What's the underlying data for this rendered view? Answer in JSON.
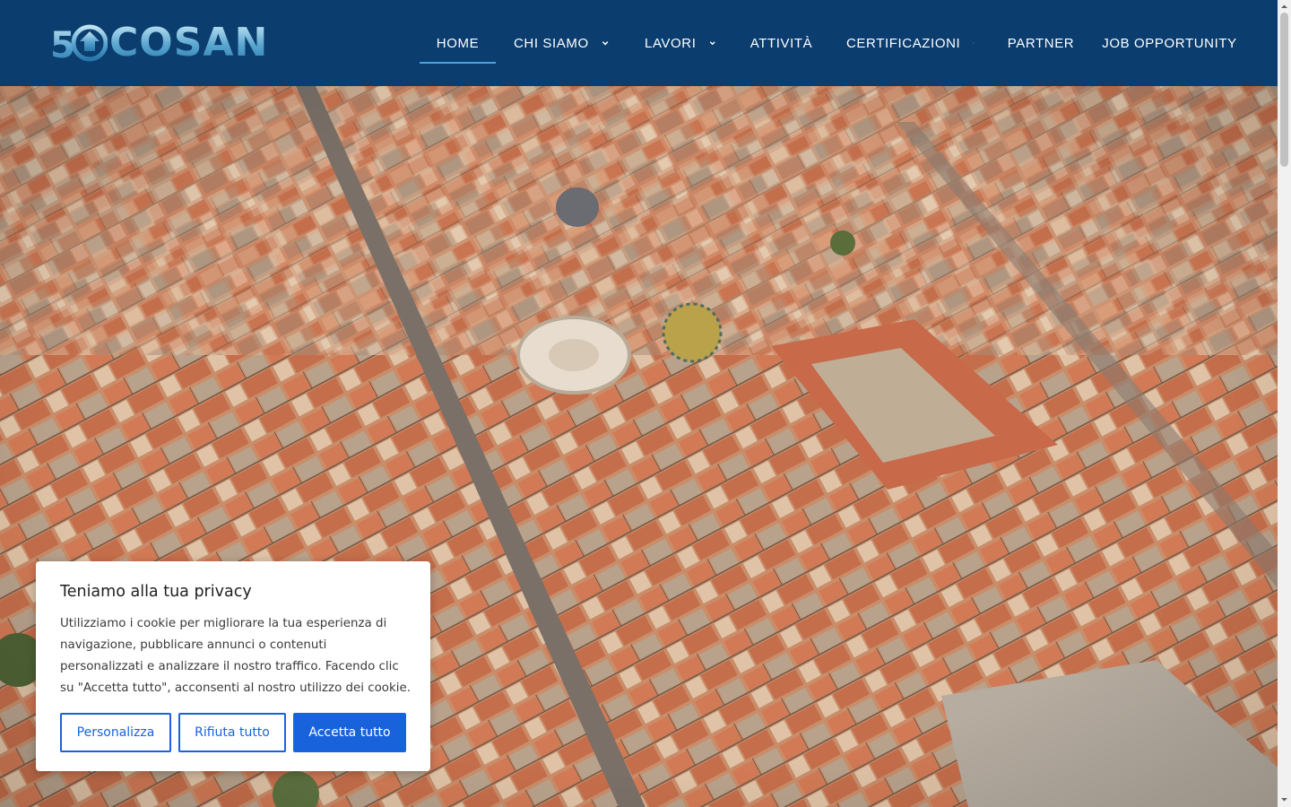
{
  "logo": {
    "mark_text": "50",
    "name": "COSAN"
  },
  "nav": {
    "items": [
      {
        "label": "HOME",
        "active": true,
        "dropdown": false
      },
      {
        "label": "CHI SIAMO",
        "active": false,
        "dropdown": true
      },
      {
        "label": "LAVORI",
        "active": false,
        "dropdown": true
      },
      {
        "label": "ATTIVITÀ",
        "active": false,
        "dropdown": false
      },
      {
        "label": "CERTIFICAZIONI",
        "active": false,
        "dropdown": true
      },
      {
        "label": "PARTNER",
        "active": false,
        "dropdown": false
      },
      {
        "label": "JOB OPPORTUNITY",
        "active": false,
        "dropdown": false
      }
    ]
  },
  "cookie": {
    "title": "Teniamo alla tua privacy",
    "text": "Utilizziamo i cookie per migliorare la tua esperienza di navigazione, pubblicare annunci o contenuti personalizzati e analizzare il nostro traffico. Facendo clic su \"Accetta tutto\", acconsenti al nostro utilizzo dei cookie.",
    "customize_label": "Personalizza",
    "reject_label": "Rifiuta tutto",
    "accept_label": "Accetta tutto"
  },
  "colors": {
    "header_bg": "#0b3d6e",
    "nav_underline": "#4aa3df",
    "button_blue": "#1863dc"
  }
}
